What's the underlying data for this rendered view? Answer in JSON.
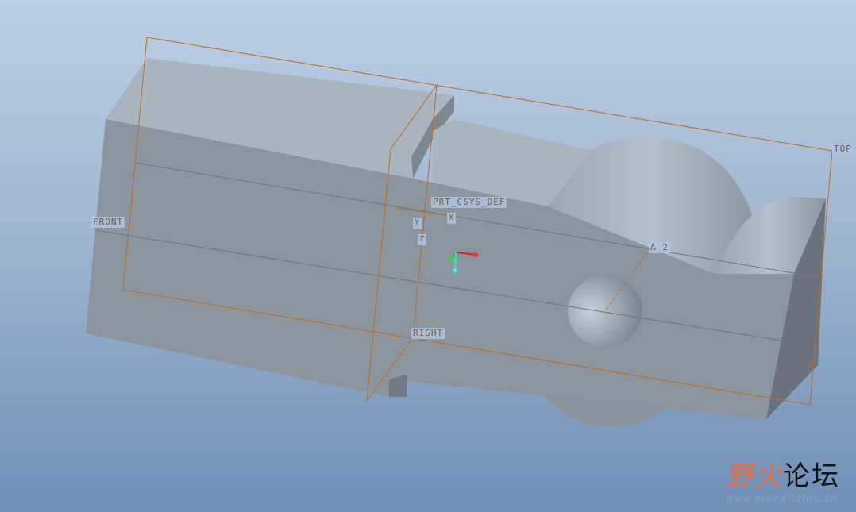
{
  "datums": {
    "front": "FRONT",
    "top": "TOP",
    "right": "RIGHT",
    "csys": "PRT_CSYS_DEF",
    "axis": "A_2"
  },
  "csys_axes": {
    "x": "X",
    "y": "Y",
    "z": "Z"
  },
  "watermark": {
    "title_colored": "野火",
    "title_rest": "论坛",
    "url": "www.proewildfire.cn"
  },
  "colors": {
    "datum": "#c06a20",
    "model": "#8a959e",
    "accent": "#f26a3a"
  }
}
